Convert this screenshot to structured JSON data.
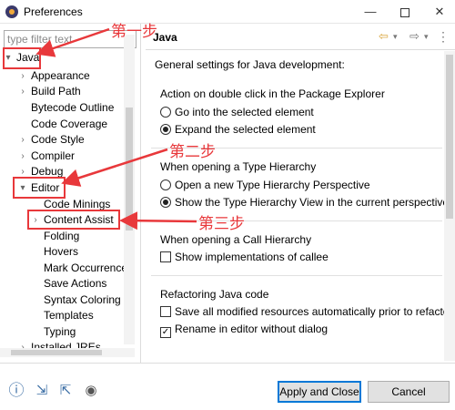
{
  "window": {
    "title": "Preferences",
    "controls": {
      "minimize": "—",
      "close": "✕"
    }
  },
  "filter": {
    "placeholder": "type filter text"
  },
  "tree": {
    "items": [
      {
        "label": "Java",
        "expanded": true
      },
      {
        "label": "Appearance"
      },
      {
        "label": "Build Path"
      },
      {
        "label": "Bytecode Outline"
      },
      {
        "label": "Code Coverage"
      },
      {
        "label": "Code Style"
      },
      {
        "label": "Compiler"
      },
      {
        "label": "Debug"
      },
      {
        "label": "Editor",
        "expanded": true
      },
      {
        "label": "Code Minings"
      },
      {
        "label": "Content Assist"
      },
      {
        "label": "Folding"
      },
      {
        "label": "Hovers"
      },
      {
        "label": "Mark Occurrences"
      },
      {
        "label": "Save Actions"
      },
      {
        "label": "Syntax Coloring"
      },
      {
        "label": "Templates"
      },
      {
        "label": "Typing"
      },
      {
        "label": "Installed JREs"
      }
    ]
  },
  "page": {
    "title": "Java",
    "description": "General settings for Java development:",
    "groups": [
      {
        "title": "Action on double click in the Package Explorer",
        "options": [
          {
            "label": "Go into the selected element",
            "selected": false
          },
          {
            "label": "Expand the selected element",
            "selected": true
          }
        ]
      },
      {
        "title": "When opening a Type Hierarchy",
        "options": [
          {
            "label": "Open a new Type Hierarchy Perspective",
            "selected": false
          },
          {
            "label": "Show the Type Hierarchy View in the current perspective",
            "selected": true
          }
        ]
      },
      {
        "title": "When opening a Call Hierarchy",
        "checks": [
          {
            "label": "Show implementations of callee",
            "checked": false
          }
        ]
      },
      {
        "title": "Refactoring Java code",
        "checks": [
          {
            "label": "Save all modified resources automatically prior to refactoring",
            "checked": false
          },
          {
            "label": "Rename in editor without dialog",
            "checked": true
          }
        ]
      }
    ]
  },
  "buttons": {
    "apply_close": "Apply and Close",
    "cancel": "Cancel"
  },
  "bottom_icons": [
    "help-icon",
    "import-icon",
    "export-icon",
    "oomph-icon"
  ],
  "annotations": {
    "step1": "第一步",
    "step2": "第二步",
    "step3": "第三步"
  },
  "colors": {
    "annotation": "#e8383b",
    "primary_border": "#0078d7"
  }
}
